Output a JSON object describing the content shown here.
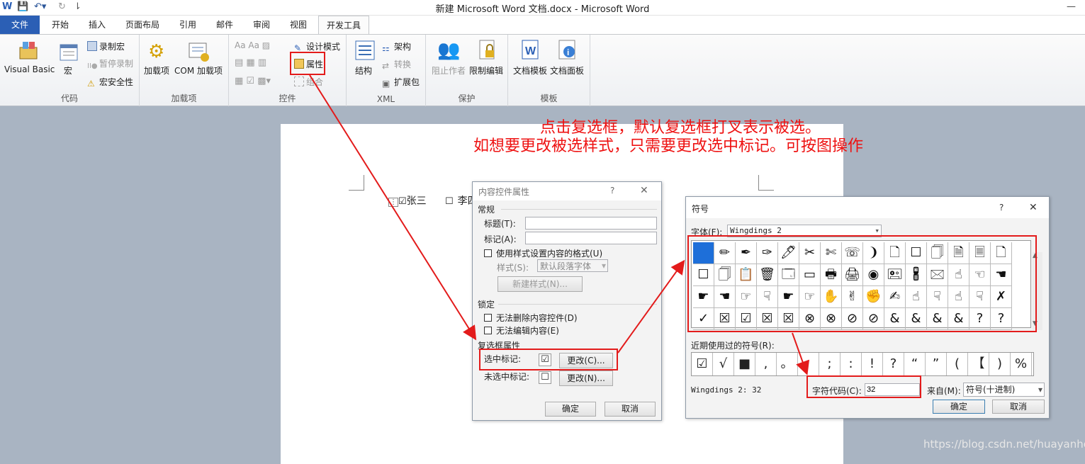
{
  "window": {
    "title": "新建 Microsoft Word 文档.docx  -  Microsoft Word"
  },
  "tabs": [
    {
      "label": "文件",
      "kind": "file"
    },
    {
      "label": "开始"
    },
    {
      "label": "插入"
    },
    {
      "label": "页面布局"
    },
    {
      "label": "引用"
    },
    {
      "label": "邮件"
    },
    {
      "label": "审阅"
    },
    {
      "label": "视图"
    },
    {
      "label": "开发工具",
      "active": true
    }
  ],
  "ribbon": {
    "code": {
      "label": "代码",
      "visual_basic": "Visual Basic",
      "macros": "宏",
      "record_macro": "录制宏",
      "pause_recording": "暂停录制",
      "macro_security": "宏安全性"
    },
    "addins": {
      "label": "加载项",
      "addins": "加载项",
      "com_addins": "COM 加载项"
    },
    "controls": {
      "label": "控件",
      "design_mode": "设计模式",
      "properties": "属性",
      "group": "组合"
    },
    "xml": {
      "label": "XML",
      "structure": "结构",
      "schema": "架构",
      "transform": "转换",
      "expansion_packs": "扩展包"
    },
    "protect": {
      "label": "保护",
      "block_authors": "阻止作者",
      "restrict_editing": "限制编辑"
    },
    "templates": {
      "label": "模板",
      "document_template": "文档模板",
      "document_panel": "文档面板"
    }
  },
  "document": {
    "name1": "张三",
    "name2": "李四"
  },
  "annotation": {
    "line1": "点击复选框，默认复选框打叉表示被选。",
    "line2": "如想要更改被选样式，只需要更改选中标记。可按图操作"
  },
  "props_dialog": {
    "title": "内容控件属性",
    "help": "?",
    "close": "✕",
    "general": "常规",
    "title_label": "标题(T):",
    "tag_label": "标记(A):",
    "title_value": "",
    "tag_value": "",
    "use_style": "使用样式设置内容的格式(U)",
    "style_label": "样式(S):",
    "style_value": "默认段落字体",
    "new_style": "新建样式(N)...",
    "locking": "锁定",
    "no_delete": "无法删除内容控件(D)",
    "no_edit": "无法编辑内容(E)",
    "checkbox_props": "复选框属性",
    "checked_symbol_label": "选中标记:",
    "checked_symbol": "☑",
    "unchecked_symbol_label": "未选中标记:",
    "unchecked_symbol": "☐",
    "change_checked": "更改(C)...",
    "change_unchecked": "更改(N)...",
    "ok": "确定",
    "cancel": "取消"
  },
  "symbol_dialog": {
    "title": "符号",
    "help": "?",
    "close": "✕",
    "font_label": "字体(F):",
    "font_value": "Wingdings 2",
    "grid": [
      [
        "",
        "✏",
        "✒",
        "✑",
        "🖊",
        "✂",
        "✄",
        "☏",
        "❩",
        "🗋",
        "☐",
        "🗍",
        "🗎",
        "🗏",
        "🗋"
      ],
      [
        "☐",
        "🗍",
        "📋",
        "🗑",
        "🗔",
        "▭",
        "🖶",
        "🖨",
        "◉",
        "🖭",
        "🖁",
        "🖂",
        "☝",
        "☜",
        "☚"
      ],
      [
        "☛",
        "☚",
        "☞",
        "☟",
        "☛",
        "☞",
        "✋",
        "✌",
        "✊",
        "✍",
        "☝",
        "☟",
        "☝",
        "☟",
        "✗"
      ],
      [
        "✓",
        "☒",
        "☑",
        "☒",
        "☒",
        "⊗",
        "⊗",
        "⊘",
        "⊘",
        "&",
        "&",
        "&",
        "&",
        "?",
        "?"
      ]
    ],
    "recent_label": "近期使用过的符号(R):",
    "recent": [
      "☑",
      "√",
      "■",
      ",",
      "。",
      "、",
      ";",
      ":",
      "!",
      "?",
      "“",
      "”",
      "(",
      "【",
      ")",
      "%"
    ],
    "char_name": "Wingdings 2: 32",
    "char_code_label": "字符代码(C):",
    "char_code": "32",
    "from_label": "来自(M):",
    "from_value": "符号(十进制)",
    "ok": "确定",
    "cancel": "取消"
  },
  "watermark": "https://blog.csdn.net/huayanhe",
  "colors": {
    "accent_file_tab": "#2b5fb5",
    "annotation_red": "#ee1111",
    "selected_cell": "#1e6fd9"
  }
}
